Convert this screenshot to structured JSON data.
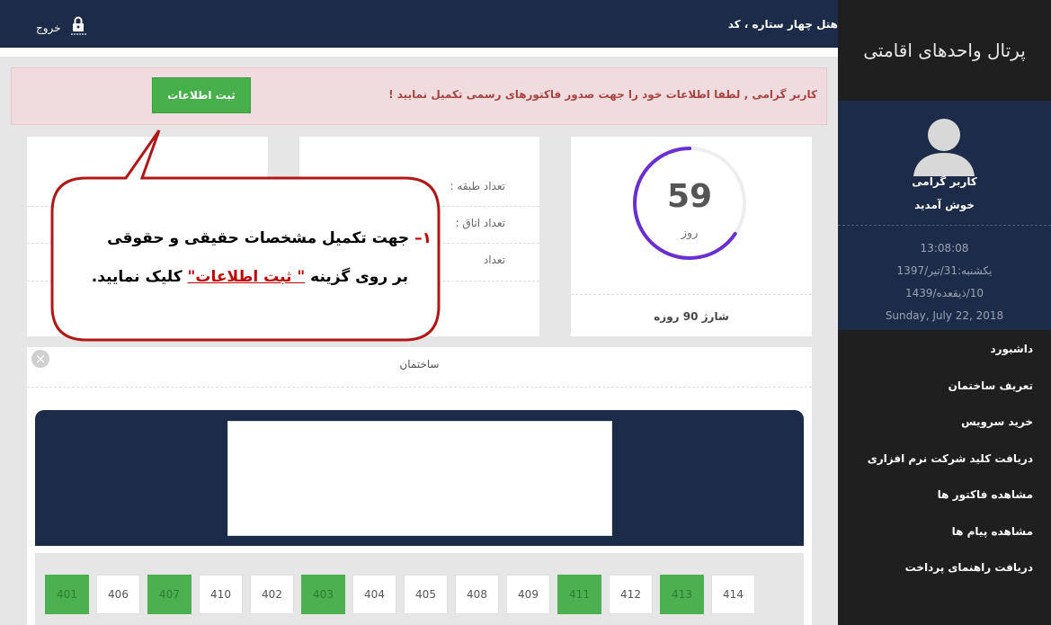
{
  "topbar": {
    "hotel_title": "هتل چهار ستاره ، کد",
    "logout_label": "خروج",
    "lock_icon": "lock-icon"
  },
  "sidebar": {
    "brand": "پرتال واحدهای اقامتی",
    "greeting_line1": "کاربر گرامی",
    "greeting_line2": "خوش آمدید",
    "time": "13:08:08",
    "date_shamsi": "یکشنبه:31/تیر/1397",
    "date_hijri": "10/ذیقعده/1439",
    "date_gregorian": "Sunday, July 22, 2018",
    "nav": [
      {
        "label": "داشبورد"
      },
      {
        "label": "تعریف ساختمان"
      },
      {
        "label": "خرید سرویس"
      },
      {
        "label": "دریافت کلید شرکت نرم افزاری"
      },
      {
        "label": "مشاهده فاکتور ها"
      },
      {
        "label": "مشاهده پیام ها"
      },
      {
        "label": "دریافت راهنمای پرداخت"
      }
    ]
  },
  "alert": {
    "text": "کاربر گرامی , لطفا اطلاعات خود را جهت صدور فاکتورهای رسمی تکمیل نمایید !",
    "button_label": "ثبت اطلاعات"
  },
  "days_card": {
    "value": "59",
    "unit": "روز",
    "charge_label": "شارژ 90 روزه",
    "progress_fraction": 0.656
  },
  "stats_card": {
    "floors_label": "تعداد طبقه :",
    "rooms_label": "تعداد اتاق :",
    "third_label_partial": "تعداد"
  },
  "building": {
    "title": "ساختمان",
    "close_icon": "close-icon",
    "rooms": [
      {
        "number": "401",
        "occupied": true
      },
      {
        "number": "406",
        "occupied": false
      },
      {
        "number": "407",
        "occupied": true
      },
      {
        "number": "410",
        "occupied": false
      },
      {
        "number": "402",
        "occupied": false
      },
      {
        "number": "403",
        "occupied": true
      },
      {
        "number": "404",
        "occupied": false
      },
      {
        "number": "405",
        "occupied": false
      },
      {
        "number": "408",
        "occupied": false
      },
      {
        "number": "409",
        "occupied": false
      },
      {
        "number": "411",
        "occupied": true
      },
      {
        "number": "412",
        "occupied": false
      },
      {
        "number": "413",
        "occupied": true
      },
      {
        "number": "414",
        "occupied": false
      }
    ]
  },
  "callout": {
    "number": "۱–",
    "line1_text": " جهت تکمیل مشخصات حقیقی و حقوقی",
    "line2_prefix": "بر روی گزینه ",
    "line2_highlight": "\" ثبت اطلاعات\"",
    "line2_suffix": " کلیک نمایید."
  },
  "colors": {
    "navy": "#1c2b47",
    "sidebar_bg": "#1f1f1f",
    "green": "#47b04b",
    "alert_bg": "#f0dcdf",
    "alert_text": "#a94442",
    "progress_purple": "#6a2fd0",
    "callout_border": "#b01818"
  }
}
